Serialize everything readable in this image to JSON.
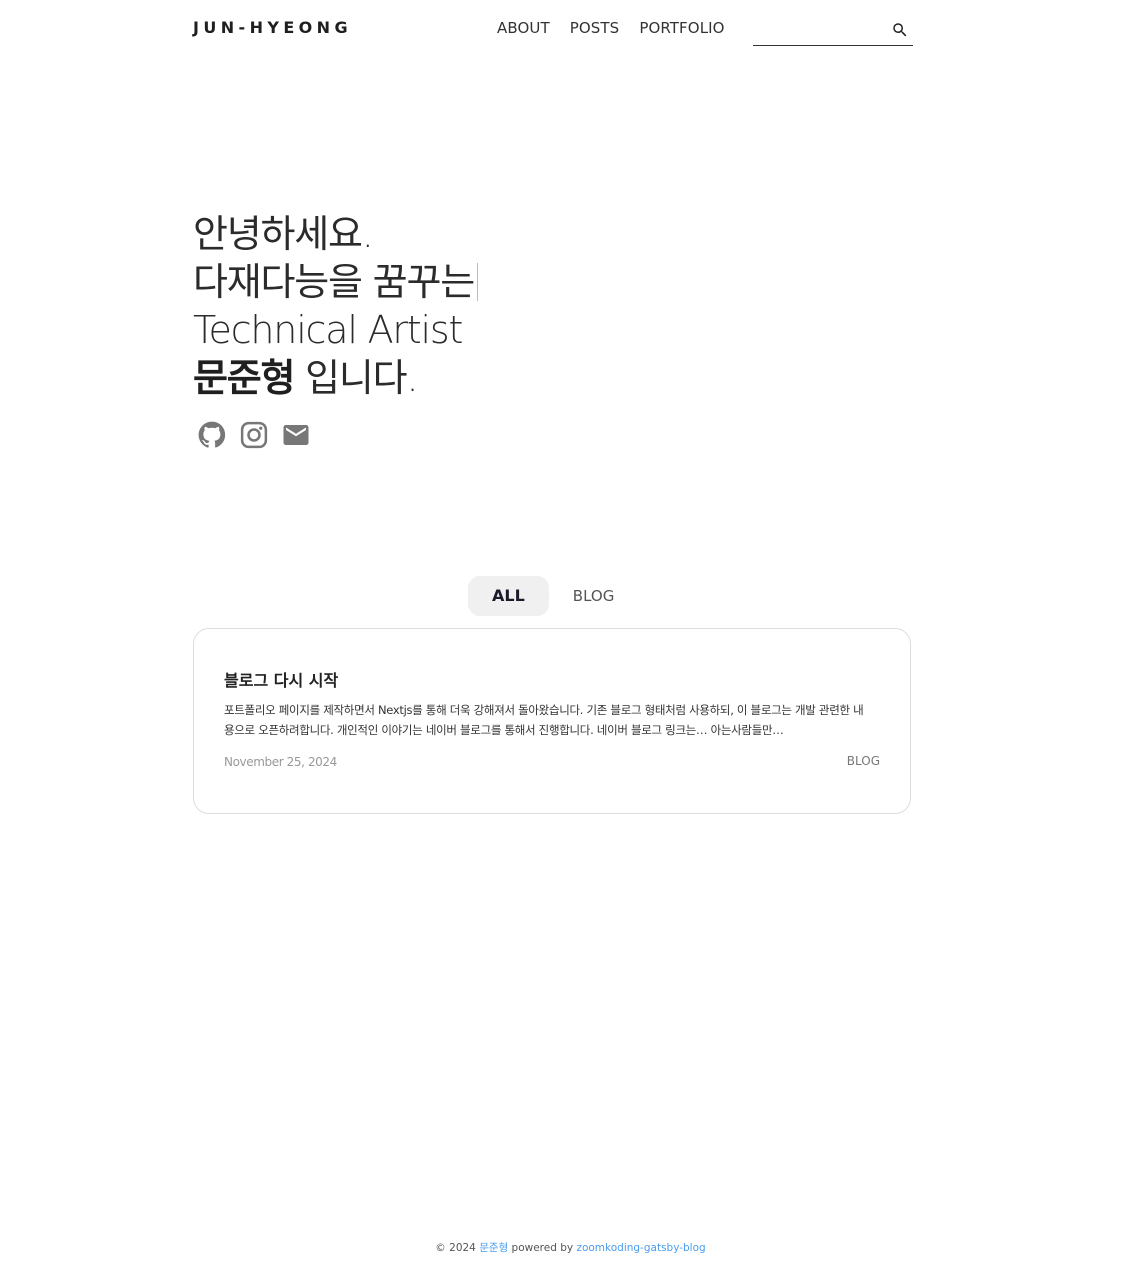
{
  "header": {
    "logo": "JUN-HYEONG",
    "nav": [
      {
        "label": "ABOUT"
      },
      {
        "label": "POSTS"
      },
      {
        "label": "PORTFOLIO"
      }
    ],
    "search": {
      "value": "",
      "placeholder": "",
      "icon": "search-icon"
    }
  },
  "hero": {
    "line1": "안녕하세요.",
    "line2": "다재다능을 꿈꾸는",
    "line3": "Technical Artist",
    "name": "문준형",
    "line4_suffix": " 입니다.",
    "social": [
      {
        "icon": "github-icon"
      },
      {
        "icon": "instagram-icon"
      },
      {
        "icon": "mail-icon"
      }
    ]
  },
  "tabs": [
    {
      "label": "ALL",
      "active": true
    },
    {
      "label": "BLOG",
      "active": false
    }
  ],
  "posts": [
    {
      "title": "블로그 다시 시작",
      "excerpt": "포트폴리오 페이지를 제작하면서 Nextjs를 통해 더욱 강해져서 돌아왔습니다. 기존 블로그 형태처럼 사용하되, 이 블로그는 개발 관련한 내용으로 오픈하려합니다. 개인적인 이야기는 네이버 블로그를 통해서 진행합니다. 네이버 블로그 링크는… 아는사람들만…",
      "date": "November 25, 2024",
      "category": "BLOG"
    }
  ],
  "footer": {
    "prefix": "© 2024 ",
    "author": "문준형",
    "middle": " powered by ",
    "link": "zoomkoding-gatsby-blog"
  },
  "colors": {
    "link": "#4a9df0",
    "icon": "#777777",
    "card_border": "#dddddd",
    "tab_active_bg": "#f0f0f0"
  }
}
